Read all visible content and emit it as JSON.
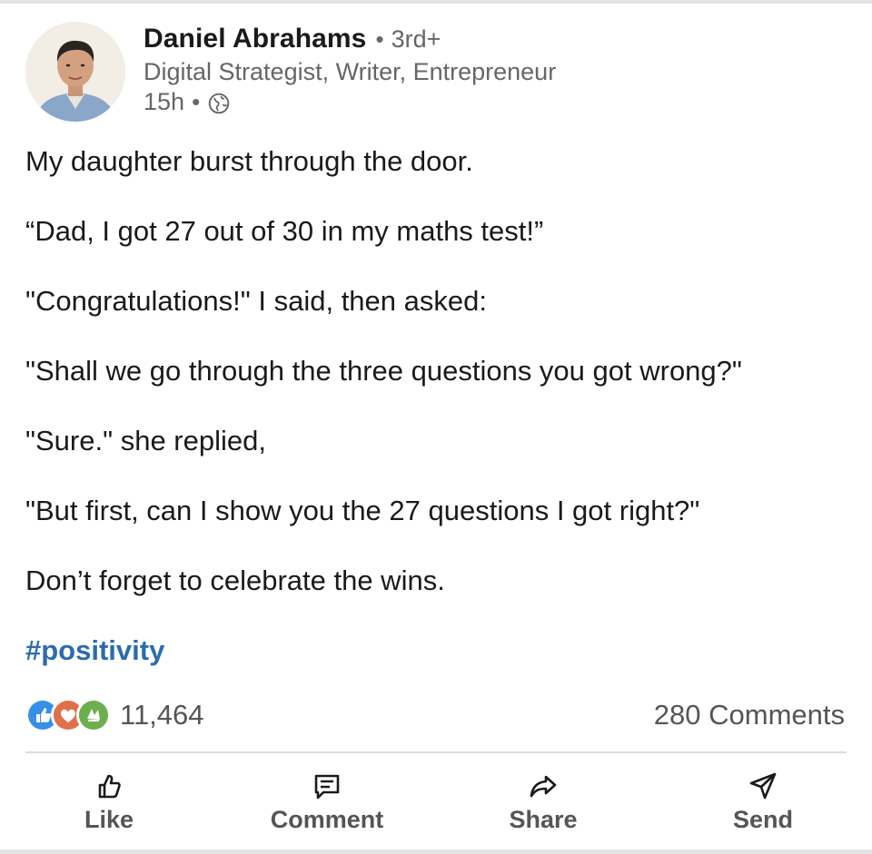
{
  "author": {
    "name": "Daniel Abrahams",
    "degree": "3rd+",
    "headline": "Digital Strategist, Writer, Entrepreneur",
    "time": "15h",
    "separator": "•"
  },
  "post": {
    "paragraphs": [
      "My daughter burst through the door.",
      "“Dad, I got 27 out of 30 in my maths test!”",
      "\"Congratulations!\" I said, then asked:",
      "\"Shall we go through the three questions you got wrong?\"",
      "\"Sure.\" she replied,",
      "\"But first, can I show you the 27 questions I got right?\"",
      "Don’t forget to celebrate the wins."
    ],
    "hashtag": "#positivity"
  },
  "social": {
    "reaction_count": "11,464",
    "comments_count": "280 Comments",
    "reaction_icons": [
      "like-icon",
      "love-icon",
      "celebrate-icon"
    ]
  },
  "actions": {
    "like": "Like",
    "comment": "Comment",
    "share": "Share",
    "send": "Send"
  },
  "colors": {
    "hashtag": "#2b6cb0",
    "like_blue": "#378fe9",
    "love_red": "#df704d",
    "celebrate_green": "#6dae4f",
    "secondary_text": "#666666"
  }
}
